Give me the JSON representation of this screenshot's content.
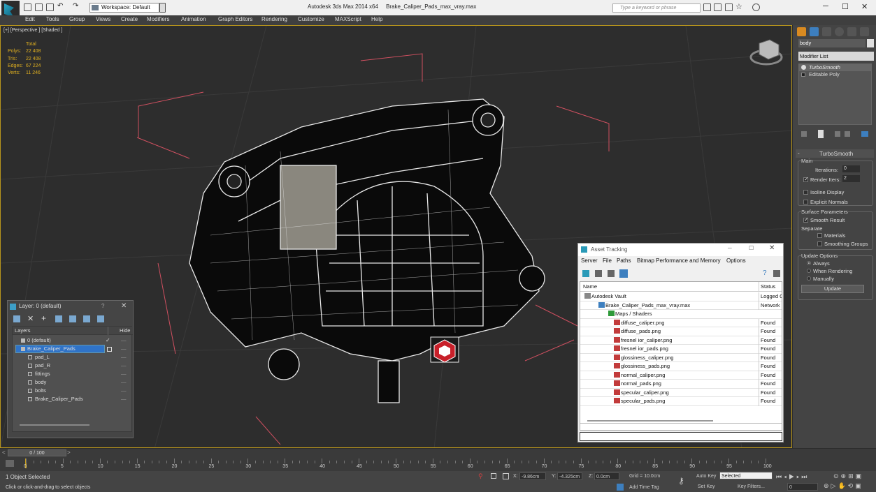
{
  "titlebar": {
    "workspace": "Workspace: Default",
    "app_name": "Autodesk 3ds Max  2014 x64",
    "file_name": "Brake_Caliper_Pads_max_vray.max",
    "search_placeholder": "Type a keyword or phrase"
  },
  "menu": [
    "Edit",
    "Tools",
    "Group",
    "Views",
    "Create",
    "Modifiers",
    "Animation",
    "Graph Editors",
    "Rendering",
    "Customize",
    "MAXScript",
    "Help"
  ],
  "viewport": {
    "label": "[+] [Perspective ] [Shaded ]",
    "stats_header": "Total",
    "stats": [
      {
        "label": "Polys:",
        "value": "22 408"
      },
      {
        "label": "Tris:",
        "value": "22 408"
      },
      {
        "label": "Edges:",
        "value": "67 224"
      },
      {
        "label": "Verts:",
        "value": "11 246"
      }
    ]
  },
  "command_panel": {
    "object_name": "body",
    "modifier_list": "Modifier List",
    "stack": [
      "TurboSmooth",
      "Editable Poly"
    ],
    "rollout_title": "TurboSmooth",
    "main_label": "Main",
    "iterations_label": "Iterations:",
    "iterations_value": "0",
    "render_iters_label": "Render Iters:",
    "render_iters_value": "2",
    "isoline": "Isoline Display",
    "explicit": "Explicit Normals",
    "surface_params": "Surface Parameters",
    "smooth_result": "Smooth Result",
    "separate": "Separate",
    "materials": "Materials",
    "smoothing_groups": "Smoothing Groups",
    "update_options": "Update Options",
    "always": "Always",
    "when_rendering": "When Rendering",
    "manually": "Manually",
    "update_button": "Update"
  },
  "layer_window": {
    "title": "Layer: 0 (default)",
    "col_layers": "Layers",
    "col_hide": "Hide",
    "rows": [
      {
        "name": "0 (default)",
        "indent": 1,
        "selected": false
      },
      {
        "name": "Brake_Caliper_Pads",
        "indent": 1,
        "selected": true
      },
      {
        "name": "pad_L",
        "indent": 2,
        "selected": false
      },
      {
        "name": "pad_R",
        "indent": 2,
        "selected": false
      },
      {
        "name": "fittings",
        "indent": 2,
        "selected": false
      },
      {
        "name": "body",
        "indent": 2,
        "selected": false
      },
      {
        "name": "bolts",
        "indent": 2,
        "selected": false
      },
      {
        "name": "Brake_Caliper_Pads",
        "indent": 2,
        "selected": false
      }
    ]
  },
  "asset_window": {
    "title": "Asset Tracking",
    "menu": [
      "Server",
      "File",
      "Paths",
      "Bitmap Performance and Memory",
      "Options"
    ],
    "col_name": "Name",
    "col_status": "Status",
    "rows": [
      {
        "name": "Autodesk Vault",
        "status": "Logged O",
        "level": 1
      },
      {
        "name": "Brake_Caliper_Pads_max_vray.max",
        "status": "Network P",
        "level": 2
      },
      {
        "name": "Maps / Shaders",
        "status": "",
        "level": 3
      },
      {
        "name": "diffuse_caliper.png",
        "status": "Found",
        "level": 4
      },
      {
        "name": "diffuse_pads.png",
        "status": "Found",
        "level": 4
      },
      {
        "name": "fresnel ior_caliper.png",
        "status": "Found",
        "level": 4
      },
      {
        "name": "fresnel ior_pads.png",
        "status": "Found",
        "level": 4
      },
      {
        "name": "glossiness_caliper.png",
        "status": "Found",
        "level": 4
      },
      {
        "name": "glossiness_pads.png",
        "status": "Found",
        "level": 4
      },
      {
        "name": "normal_caliper.png",
        "status": "Found",
        "level": 4
      },
      {
        "name": "normal_pads.png",
        "status": "Found",
        "level": 4
      },
      {
        "name": "specular_caliper.png",
        "status": "Found",
        "level": 4
      },
      {
        "name": "specular_pads.png",
        "status": "Found",
        "level": 4
      }
    ]
  },
  "timeline": {
    "frame_label": "0 / 100",
    "ticks": [
      "0",
      "5",
      "10",
      "15",
      "20",
      "25",
      "30",
      "35",
      "40",
      "45",
      "50",
      "55",
      "60",
      "65",
      "70",
      "75",
      "80",
      "85",
      "90",
      "95",
      "100"
    ]
  },
  "status": {
    "selection": "1 Object Selected",
    "hint": "Click or click-and-drag to select objects",
    "x_label": "X:",
    "x_value": "-9.86cm",
    "y_label": "Y:",
    "y_value": "-4.325cm",
    "z_label": "Z:",
    "z_value": "0.0cm",
    "grid": "Grid = 10.0cm",
    "add_time_tag": "Add Time Tag",
    "auto_key": "Auto Key",
    "selected_option": "Selected",
    "set_key": "Set Key",
    "key_filters": "Key Filters...",
    "frame_field": "0"
  }
}
